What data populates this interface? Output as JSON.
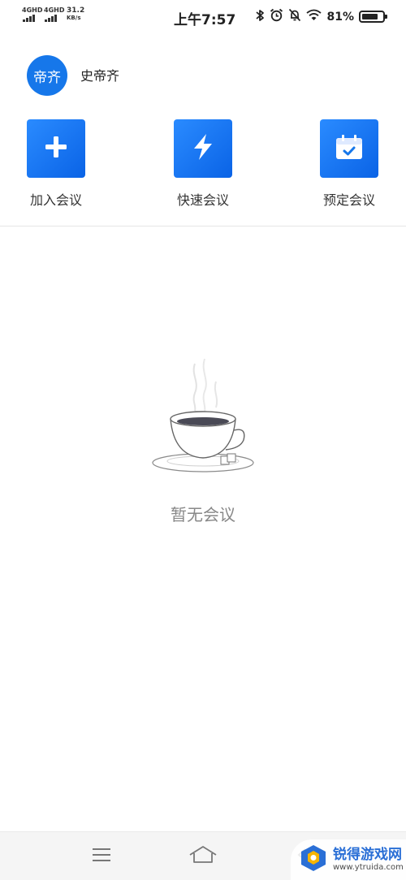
{
  "status_bar": {
    "sim1": "4GHD",
    "sim2": "4GHD",
    "net_speed_value": "31.2",
    "net_speed_unit": "KB/s",
    "time": "上午7:57",
    "battery_percent": "81%",
    "battery_level": 0.81,
    "icons": [
      "bluetooth-icon",
      "alarm-icon",
      "mute-bell-icon",
      "wifi-icon",
      "battery-icon"
    ]
  },
  "user": {
    "avatar_text": "帝齐",
    "name": "史帝齐"
  },
  "actions": [
    {
      "label": "加入会议",
      "icon": "plus-icon"
    },
    {
      "label": "快速会议",
      "icon": "lightning-icon"
    },
    {
      "label": "预定会议",
      "icon": "calendar-check-icon"
    }
  ],
  "empty_state": {
    "text": "暂无会议",
    "icon": "coffee-cup-icon"
  },
  "nav_bar": {
    "icons": [
      "menu-icon",
      "home-icon",
      "back-icon"
    ]
  },
  "watermark": {
    "name": "锐得游戏网",
    "url": "www.ytruida.com"
  },
  "colors": {
    "accent": "#1677ea",
    "tile_gradient_start": "#2a8bff",
    "tile_gradient_end": "#0a63e6",
    "empty_text": "#888888"
  }
}
